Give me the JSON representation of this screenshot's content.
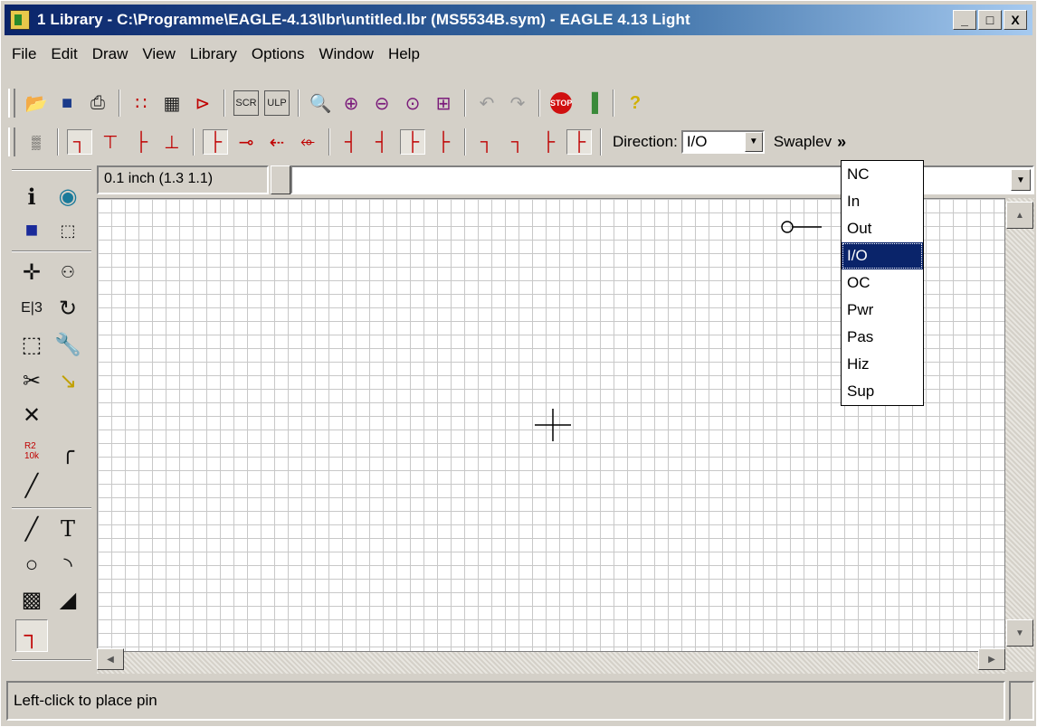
{
  "window": {
    "title": "1 Library - C:\\Programme\\EAGLE-4.13\\lbr\\untitled.lbr (MS5534B.sym) - EAGLE 4.13 Light",
    "buttons": {
      "minimize": "_",
      "maximize": "□",
      "close": "X"
    }
  },
  "menu": [
    "File",
    "Edit",
    "Draw",
    "View",
    "Library",
    "Options",
    "Window",
    "Help"
  ],
  "pin_toolbar": {
    "direction_label": "Direction:",
    "direction_value": "I/O",
    "swaplevel_label": "Swaplev",
    "more": "»"
  },
  "coord": {
    "grid_text": "0.1 inch (1.3 1.1)"
  },
  "command_line": {
    "value": ""
  },
  "direction_dropdown": {
    "options": [
      "NC",
      "In",
      "Out",
      "I/O",
      "OC",
      "Pwr",
      "Pas",
      "Hiz",
      "Sup"
    ],
    "selected": "I/O"
  },
  "status": {
    "text": "Left-click to place pin"
  },
  "icons": {
    "toolbar1": [
      "open-icon",
      "save-icon",
      "print-icon",
      "package-icon",
      "symbol-icon",
      "device-icon",
      "script-icon",
      "ulp-icon",
      "zoom-fit-icon",
      "zoom-in-icon",
      "zoom-out-icon",
      "zoom-redraw-icon",
      "zoom-select-icon",
      "undo-icon",
      "redo-icon",
      "stop-icon",
      "go-icon",
      "help-icon"
    ],
    "toolbar2": [
      "grid-icon",
      "pin-orient-icons",
      "pin-function-icons",
      "pin-length-icons",
      "pin-visible-icons"
    ]
  },
  "colors": {
    "title_start": "#0a246a",
    "title_end": "#a6caf0",
    "selection": "#0a246a",
    "grid": "#c8c8c8",
    "accent_red": "#c00000"
  }
}
